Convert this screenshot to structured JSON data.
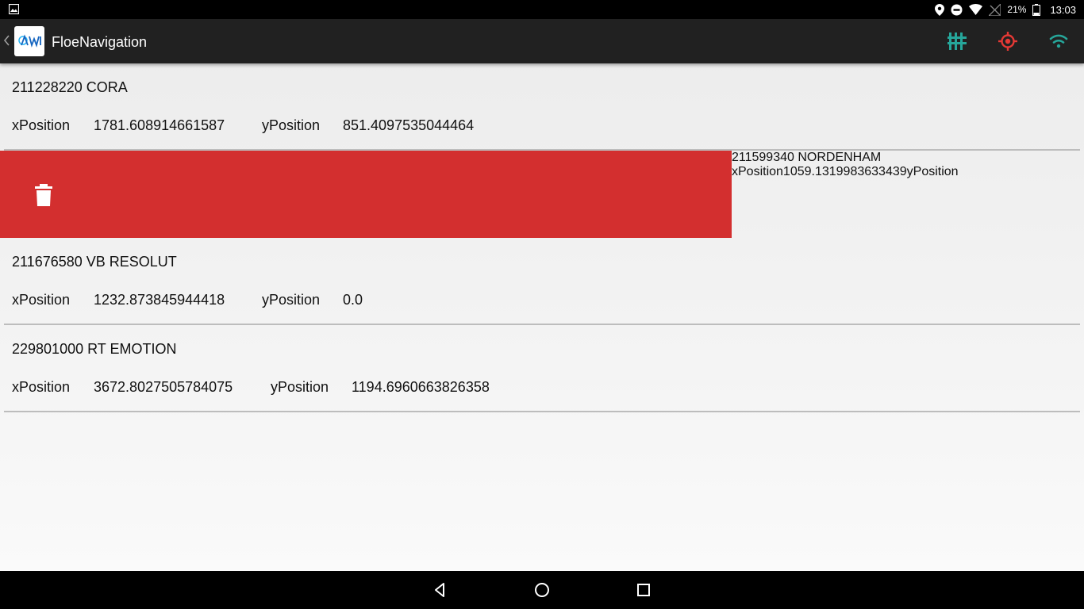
{
  "status_bar": {
    "battery_percent": "21%",
    "time": "13:03",
    "icons": [
      "image-icon",
      "location-icon",
      "do-not-disturb-icon",
      "wifi-icon",
      "no-signal-icon",
      "battery-icon"
    ]
  },
  "app_bar": {
    "title": "FloeNavigation",
    "logo_text": "AWI",
    "actions": [
      {
        "name": "sensor-settings-icon",
        "color": "#26a69a"
      },
      {
        "name": "gps-target-icon",
        "color": "#e53935"
      },
      {
        "name": "wifi-status-icon",
        "color": "#26a69a"
      }
    ]
  },
  "list": {
    "x_label": "xPosition",
    "y_label": "yPosition",
    "items": [
      {
        "name": "211228220 CORA",
        "x": "1781.608914661587",
        "y": "851.4097535044464"
      },
      {
        "name": "211599340 NORDENHAM",
        "x": "1059.1319983633439",
        "y": ""
      },
      {
        "name": "211676580 VB RESOLUT",
        "x": "1232.873845944418",
        "y": "0.0"
      },
      {
        "name": "229801000 RT EMOTION",
        "x": "3672.8027505784075",
        "y": "1194.6960663826358"
      }
    ],
    "swipe_delete_color": "#d32f2f"
  },
  "nav_bar": {
    "buttons": [
      "back-icon",
      "home-icon",
      "recents-icon"
    ]
  }
}
